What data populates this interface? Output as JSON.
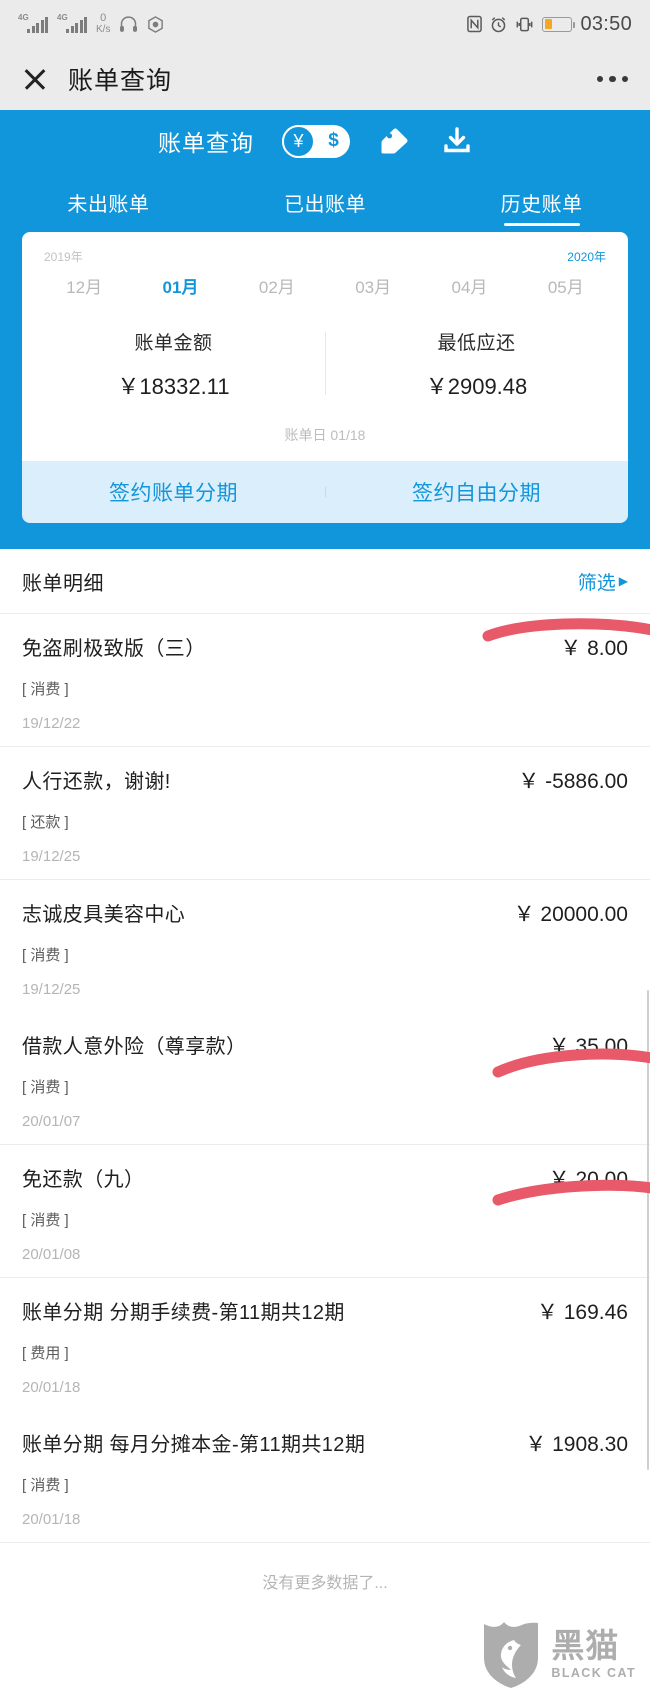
{
  "statusbar": {
    "signal1": "4G",
    "signal2": "4G",
    "netspeed_value": "0",
    "netspeed_unit": "K/s",
    "icons": [
      "headphone-icon",
      "app-badge-icon",
      "nfc-icon",
      "alarm-icon",
      "vibrate-icon",
      "battery-icon"
    ],
    "time": "03:50"
  },
  "titlebar": {
    "close_label": "close-icon",
    "title": "账单查询",
    "more_label": "more-options-icon"
  },
  "header": {
    "title": "账单查询",
    "currency_active": "¥",
    "currency_inactive": "$",
    "tag_icon": "tag-icon",
    "download_icon": "download-icon",
    "tabs": [
      {
        "label": "未出账单",
        "active": false
      },
      {
        "label": "已出账单",
        "active": false
      },
      {
        "label": "历史账单",
        "active": true
      }
    ]
  },
  "bill_card": {
    "year_left": "2019年",
    "year_right": "2020年",
    "months": [
      {
        "label": "12月",
        "active": false
      },
      {
        "label": "01月",
        "active": true
      },
      {
        "label": "02月",
        "active": false
      },
      {
        "label": "03月",
        "active": false
      },
      {
        "label": "04月",
        "active": false
      },
      {
        "label": "05月",
        "active": false
      }
    ],
    "bill_amount_label": "账单金额",
    "bill_amount_value": "￥18332.11",
    "min_due_label": "最低应还",
    "min_due_value": "￥2909.48",
    "bill_date": "账单日 01/18",
    "stage_buttons": [
      {
        "label": "签约账单分期"
      },
      {
        "label": "签约自由分期"
      }
    ]
  },
  "detail": {
    "title": "账单明细",
    "filter_label": "筛选",
    "filter_caret": "▶",
    "groups": [
      {
        "rows": [
          {
            "name": "免盗刷极致版（三）",
            "amount": "￥ 8.00",
            "type": "[ 消费 ]",
            "date": "19/12/22"
          }
        ]
      },
      {
        "rows": [
          {
            "name": "人行还款，谢谢!",
            "amount": "￥ -5886.00",
            "type": "[ 还款 ]",
            "date": "19/12/25"
          }
        ]
      },
      {
        "rows": [
          {
            "name": "志诚皮具美容中心",
            "amount": "￥ 20000.00",
            "type": "[ 消费 ]",
            "date": "19/12/25"
          },
          {
            "name": "借款人意外险（尊享款）",
            "amount": "￥ 35.00",
            "type": "[ 消费 ]",
            "date": "20/01/07"
          }
        ]
      },
      {
        "rows": [
          {
            "name": "免还款（九）",
            "amount": "￥ 20.00",
            "type": "[ 消费 ]",
            "date": "20/01/08"
          }
        ]
      },
      {
        "rows": [
          {
            "name": "账单分期 分期手续费-第11期共12期",
            "amount": "￥ 169.46",
            "type": "[ 费用 ]",
            "date": "20/01/18"
          },
          {
            "name": "账单分期 每月分摊本金-第11期共12期",
            "amount": "￥ 1908.30",
            "type": "[ 消费 ]",
            "date": "20/01/18"
          }
        ]
      }
    ],
    "end_note": "没有更多数据了..."
  },
  "watermark": {
    "cn": "黑猫",
    "en": "BLACK CAT"
  },
  "colors": {
    "brand_blue": "#1296db",
    "stage_bg": "#dbeefb",
    "annotation_red": "#e8596a"
  }
}
